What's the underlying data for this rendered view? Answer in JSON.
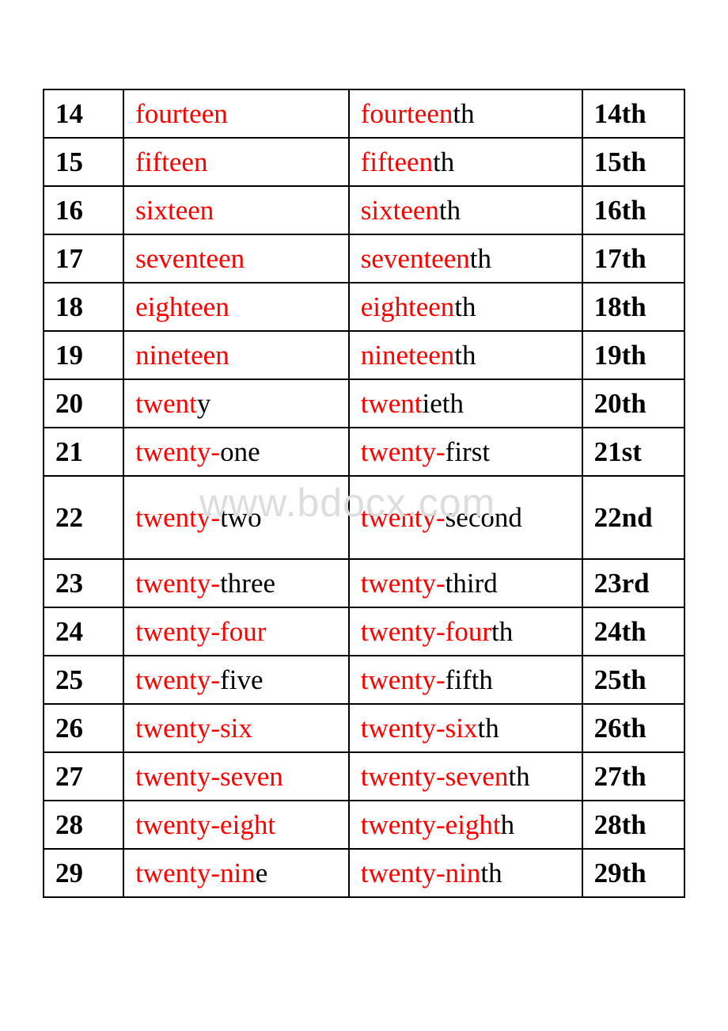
{
  "watermark": "www.bdocx.com",
  "colors": {
    "highlight": "#ff0000",
    "text": "#000000"
  },
  "rows": [
    {
      "num": "14",
      "cardinal": [
        {
          "t": "fourteen",
          "red": true
        }
      ],
      "ordinal": [
        {
          "t": "fourteen",
          "red": true
        },
        {
          "t": "th",
          "red": false
        }
      ],
      "abbr": "14th"
    },
    {
      "num": "15",
      "cardinal": [
        {
          "t": "fifteen",
          "red": true
        }
      ],
      "ordinal": [
        {
          "t": "fifteen",
          "red": true
        },
        {
          "t": "th",
          "red": false
        }
      ],
      "abbr": "15th"
    },
    {
      "num": "16",
      "cardinal": [
        {
          "t": "sixteen",
          "red": true
        }
      ],
      "ordinal": [
        {
          "t": "sixteen",
          "red": true
        },
        {
          "t": "th",
          "red": false
        }
      ],
      "abbr": "16th"
    },
    {
      "num": "17",
      "cardinal": [
        {
          "t": "seventeen",
          "red": true
        }
      ],
      "ordinal": [
        {
          "t": "seventeen",
          "red": true
        },
        {
          "t": "th",
          "red": false
        }
      ],
      "abbr": "17th"
    },
    {
      "num": "18",
      "cardinal": [
        {
          "t": "eighteen",
          "red": true
        }
      ],
      "ordinal": [
        {
          "t": "eighteen",
          "red": true
        },
        {
          "t": "th",
          "red": false
        }
      ],
      "abbr": "18th"
    },
    {
      "num": "19",
      "cardinal": [
        {
          "t": "nineteen",
          "red": true
        }
      ],
      "ordinal": [
        {
          "t": "nineteen",
          "red": true
        },
        {
          "t": "th",
          "red": false
        }
      ],
      "abbr": "19th"
    },
    {
      "num": "20",
      "cardinal": [
        {
          "t": "twent",
          "red": true
        },
        {
          "t": "y",
          "red": false
        }
      ],
      "ordinal": [
        {
          "t": "twent",
          "red": true
        },
        {
          "t": "ieth",
          "red": false
        }
      ],
      "abbr": "20th"
    },
    {
      "num": "21",
      "cardinal": [
        {
          "t": "twenty-",
          "red": true
        },
        {
          "t": "one",
          "red": false
        }
      ],
      "ordinal": [
        {
          "t": "twenty-",
          "red": true
        },
        {
          "t": "first",
          "red": false
        }
      ],
      "abbr": "21st"
    },
    {
      "num": "22",
      "tall": true,
      "cardinal": [
        {
          "t": "twenty-",
          "red": true
        },
        {
          "t": "two",
          "red": false
        }
      ],
      "ordinal": [
        {
          "t": "twenty-",
          "red": true
        },
        {
          "t": "second",
          "red": false
        }
      ],
      "abbr": "22nd"
    },
    {
      "num": "23",
      "cardinal": [
        {
          "t": "twenty-",
          "red": true
        },
        {
          "t": "three",
          "red": false
        }
      ],
      "ordinal": [
        {
          "t": "twenty-",
          "red": true
        },
        {
          "t": "third",
          "red": false
        }
      ],
      "abbr": "23rd"
    },
    {
      "num": "24",
      "cardinal": [
        {
          "t": "twenty-four",
          "red": true
        }
      ],
      "ordinal": [
        {
          "t": "twenty-four",
          "red": true
        },
        {
          "t": "th",
          "red": false
        }
      ],
      "abbr": "24th"
    },
    {
      "num": "25",
      "cardinal": [
        {
          "t": "twenty-",
          "red": true
        },
        {
          "t": "five",
          "red": false
        }
      ],
      "ordinal": [
        {
          "t": "twenty-",
          "red": true
        },
        {
          "t": "fifth",
          "red": false
        }
      ],
      "abbr": "25th"
    },
    {
      "num": "26",
      "cardinal": [
        {
          "t": "twenty-six",
          "red": true
        }
      ],
      "ordinal": [
        {
          "t": "twenty-six",
          "red": true
        },
        {
          "t": "th",
          "red": false
        }
      ],
      "abbr": "26th"
    },
    {
      "num": "27",
      "cardinal": [
        {
          "t": "twenty-seven",
          "red": true
        }
      ],
      "ordinal": [
        {
          "t": "twenty-seven",
          "red": true
        },
        {
          "t": "th",
          "red": false
        }
      ],
      "abbr": "27th"
    },
    {
      "num": "28",
      "cardinal": [
        {
          "t": "twenty-eight",
          "red": true
        }
      ],
      "ordinal": [
        {
          "t": "twenty-eight",
          "red": true
        },
        {
          "t": "h",
          "red": false
        }
      ],
      "abbr": "28th"
    },
    {
      "num": "29",
      "cardinal": [
        {
          "t": "twenty-nin",
          "red": true
        },
        {
          "t": "e",
          "red": false
        }
      ],
      "ordinal": [
        {
          "t": "twenty-nin",
          "red": true
        },
        {
          "t": "th",
          "red": false
        }
      ],
      "abbr": "29th"
    }
  ]
}
